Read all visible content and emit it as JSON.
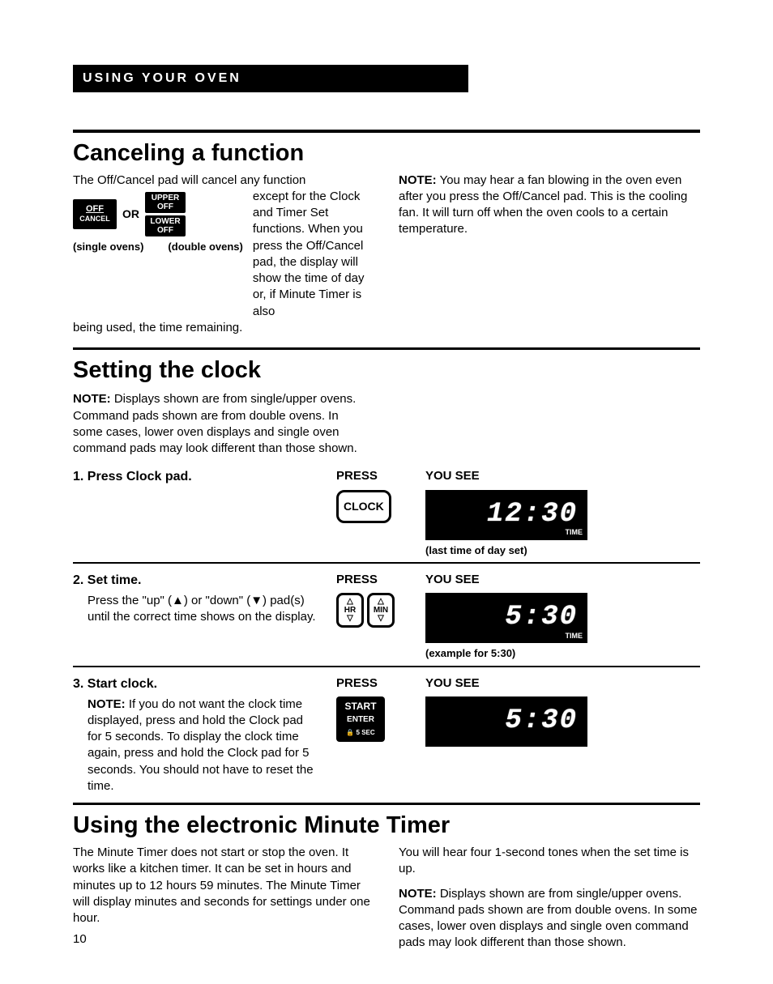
{
  "header": "USING YOUR OVEN",
  "s1": {
    "title": "Canceling a function",
    "intro": "The Off/Cancel pad will cancel any function",
    "wrap_text": "except for the Clock and Timer Set functions. When you press the Off/Cancel pad, the display will show the time of day or, if Minute Timer is also",
    "tail": "being used, the time remaining.",
    "pad_off_line1": "OFF",
    "pad_off_line2": "CANCEL",
    "pad_upper": "UPPER OFF",
    "pad_lower": "LOWER OFF",
    "or": "OR",
    "cap_single": "(single ovens)",
    "cap_double": "(double ovens)",
    "note_label": "NOTE:",
    "note_text": " You may hear a fan blowing in the oven even after you press the Off/Cancel pad. This is the cooling fan. It will turn off when the oven cools to a certain temperature."
  },
  "s2": {
    "title": "Setting the clock",
    "note_label": "NOTE:",
    "note_text": " Displays shown are from single/upper ovens. Command pads shown are from double ovens. In some cases, lower oven displays and single oven command pads may look different than those shown.",
    "press": "PRESS",
    "yousee": "YOU SEE",
    "step1": {
      "title": "1. Press Clock pad.",
      "pad": "CLOCK",
      "digits": "12:30",
      "corner": "TIME",
      "caption": "(last time of day set)"
    },
    "step2": {
      "title": "2. Set time.",
      "body": "Press the \"up\" (▲) or \"down\" (▼) pad(s) until the correct time shows on the display.",
      "hr": "HR",
      "min": "MIN",
      "digits": "5:30",
      "corner": "TIME",
      "caption": "(example for 5:30)"
    },
    "step3": {
      "title": "3. Start clock.",
      "note_label": "NOTE:",
      "body": " If you do not want the clock time displayed, press and hold the Clock pad for 5 seconds. To display the clock time again, press and hold the Clock pad for 5 seconds. You should not have to reset the time.",
      "pad_line1": "START",
      "pad_line2": "ENTER",
      "pad_line3": "🔒 5 SEC",
      "digits": "5:30"
    }
  },
  "s3": {
    "title": "Using the electronic Minute Timer",
    "left": "The Minute Timer does not start or stop the oven. It works like a kitchen timer. It can be set in hours and minutes up to 12 hours 59 minutes. The Minute Timer will display minutes and seconds for settings under one hour.",
    "r1": "You will hear four 1-second tones when the set time is up.",
    "r2_label": "NOTE:",
    "r2": " Displays shown are from single/upper ovens. Command pads shown are from double ovens. In some cases, lower oven displays and single oven command pads may look different than those shown."
  },
  "page": "10"
}
